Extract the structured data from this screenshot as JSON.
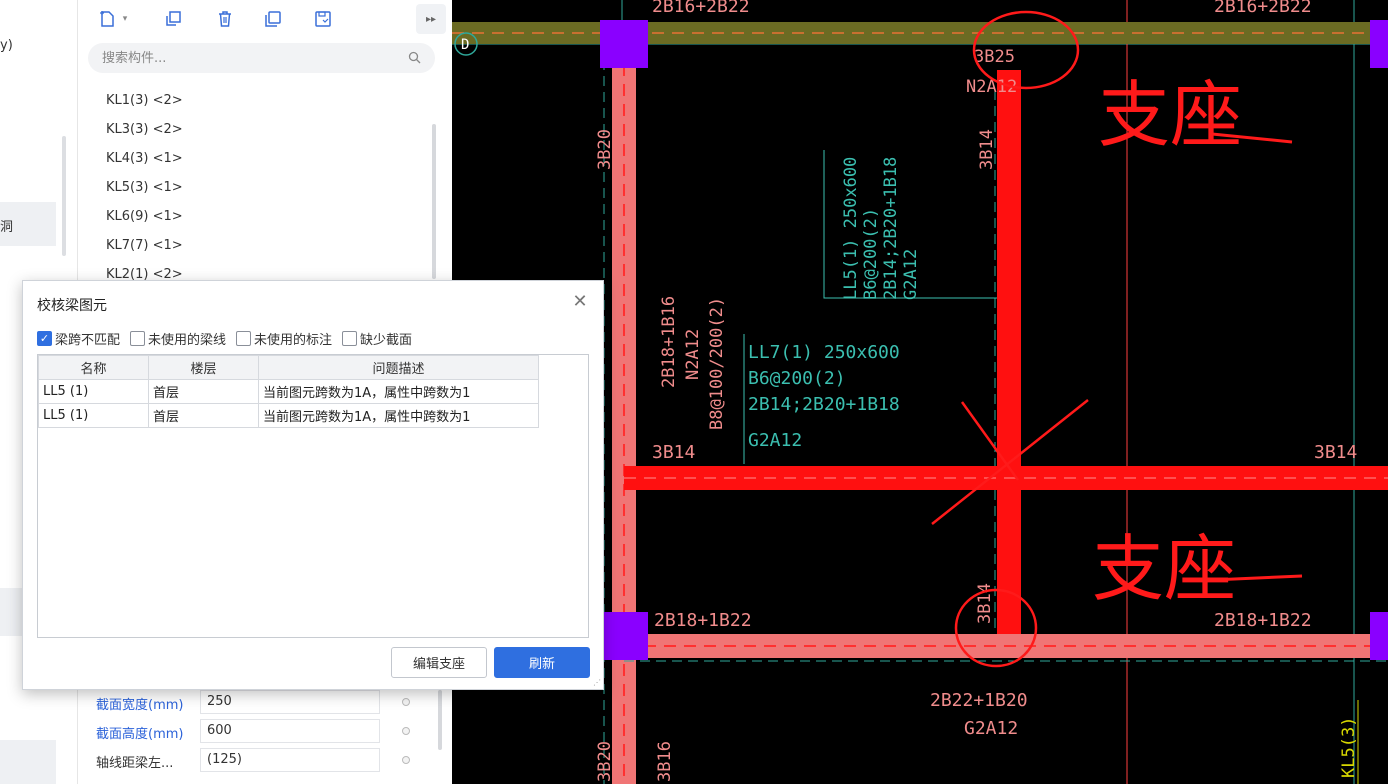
{
  "left_strip": {
    "item1": "y)",
    "item2": "洞"
  },
  "component_panel": {
    "search_placeholder": "搜索构件...",
    "items": [
      "KL1(3) <2>",
      "KL3(3) <2>",
      "KL4(3) <1>",
      "KL5(3) <1>",
      "KL6(9) <1>",
      "KL7(7) <1>",
      "KL2(1) <2>"
    ],
    "properties": [
      {
        "label": "截面宽度(mm)",
        "value": "250"
      },
      {
        "label": "截面高度(mm)",
        "value": "600"
      },
      {
        "label": "轴线距梁左...",
        "value": "(125)"
      }
    ]
  },
  "dialog": {
    "title": "校核梁图元",
    "filters": [
      {
        "label": "梁跨不匹配",
        "checked": true
      },
      {
        "label": "未使用的梁线",
        "checked": false
      },
      {
        "label": "未使用的标注",
        "checked": false
      },
      {
        "label": "缺少截面",
        "checked": false
      }
    ],
    "columns": [
      "名称",
      "楼层",
      "问题描述"
    ],
    "rows": [
      [
        "LL5 (1)",
        "首层",
        "当前图元跨数为1A，属性中跨数为1"
      ],
      [
        "LL5 (1)",
        "首层",
        "当前图元跨数为1A，属性中跨数为1"
      ]
    ],
    "edit_button": "编辑支座",
    "refresh_button": "刷新"
  },
  "cad": {
    "axis_label": "D",
    "texts": {
      "top_left": "2B16+2B22",
      "top_right": "2B16+2B22",
      "b3b25": "3B25",
      "n2a12_top": "N2A12",
      "b3b20_left": "3B20",
      "b3b14_vert": "3B14",
      "ll5_1": "LL5(1) 250x600",
      "ll5_2": "B6@200(2)",
      "ll5_3": "2B14;2B20+1B18",
      "ll5_4": "G2A12",
      "left_v1": "2B18+1B16",
      "left_v2": "N2A12",
      "left_v3": "B8@100/200(2)",
      "ll7_1": "LL7(1) 250x600",
      "ll7_2": "B6@200(2)",
      "ll7_3": "2B14;2B20+1B18",
      "ll7_4": "G2A12",
      "b3b14_left": "3B14",
      "b3b14_right": "3B14",
      "b3b14_lower": "3B14",
      "b2b18_left": "2B18+1B22",
      "b2b18_right": "2B18+1B22",
      "b2b22_1": "2B22+1B20",
      "b2b22_2": "G2A12",
      "b3b20_bottom": "3B20",
      "b3b16_bottom": "3B16",
      "kl5_3": "KL5(3)"
    },
    "annotations": [
      "支座",
      "支座"
    ],
    "colors": {
      "beam": "#ff1010",
      "beam_light": "#f07575",
      "column": "#8a00ff",
      "text": "#f08c8c",
      "dim_text": "#3bbfb0",
      "ink": "#ff1a1a"
    }
  }
}
